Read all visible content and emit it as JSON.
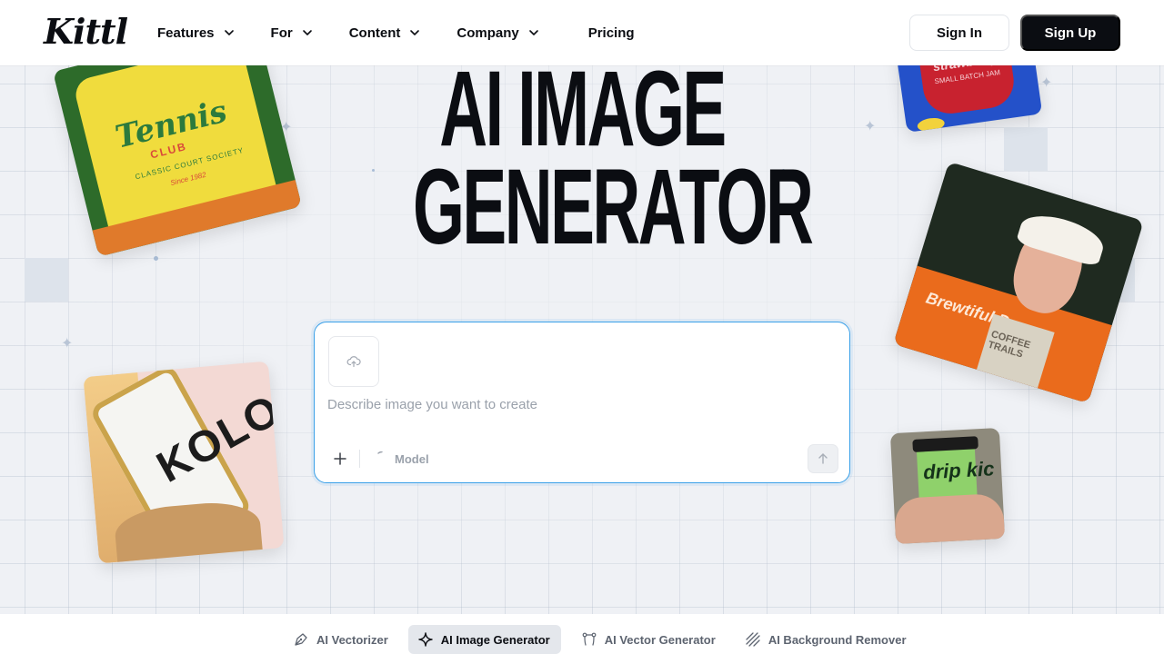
{
  "brand": {
    "logo_text": "Kittl"
  },
  "nav": {
    "items": [
      {
        "label": "Features",
        "has_dropdown": true
      },
      {
        "label": "For",
        "has_dropdown": true
      },
      {
        "label": "Content",
        "has_dropdown": true
      },
      {
        "label": "Company",
        "has_dropdown": true
      },
      {
        "label": "Pricing",
        "has_dropdown": false
      }
    ],
    "sign_in_label": "Sign In",
    "sign_up_label": "Sign Up"
  },
  "hero": {
    "title_line1": "AI IMAGE",
    "title_line2": "GENERATOR"
  },
  "prompt": {
    "placeholder": "Describe image you want to create",
    "model_label": "Model",
    "icons": {
      "upload": "cloud-upload-icon",
      "add": "plus-icon",
      "submit": "arrow-up-icon",
      "model": "spinner-icon"
    }
  },
  "photos": {
    "shirt": {
      "title": "Tennis",
      "subtitle": "CLUB",
      "line": "CLASSIC COURT SOCIETY",
      "since": "Since 1982"
    },
    "jam": {
      "label": "strawberry",
      "sub": "SMALL BATCH JAM"
    },
    "man": {
      "shirt_text": "Brewtiful Day",
      "bag_text": "COFFEE TRAILS"
    },
    "can": {
      "brand": "KOLO"
    },
    "cup": {
      "text": "drip kic"
    }
  },
  "bottom_tabs": [
    {
      "label": "AI Vectorizer",
      "icon": "pen-nib-icon",
      "active": false
    },
    {
      "label": "AI Image Generator",
      "icon": "sparkle-icon",
      "active": true
    },
    {
      "label": "AI Vector Generator",
      "icon": "bezier-curve-icon",
      "active": false
    },
    {
      "label": "AI Background Remover",
      "icon": "diagonal-lines-icon",
      "active": false
    }
  ],
  "colors": {
    "accent_border": "#3aa0e8",
    "primary_dark": "#0b0d12",
    "background": "#eff1f5"
  }
}
